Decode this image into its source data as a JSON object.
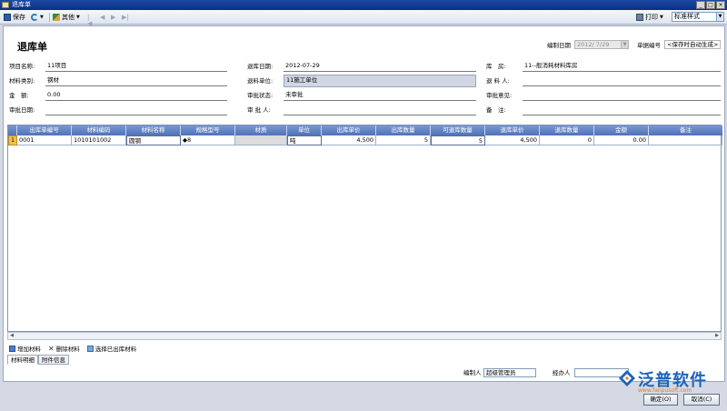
{
  "window": {
    "title": "退库单",
    "min": "_",
    "max": "□",
    "close": "×"
  },
  "toolbar": {
    "save_label": "保存",
    "other_label": "其他",
    "print_label": "打印",
    "template_value": "标准样式"
  },
  "header": {
    "title": "退库单",
    "date_label": "编制日期",
    "date_value": "2012/ 7/29",
    "no_label": "单据编号",
    "no_value": "<保存时自动生成>"
  },
  "form": {
    "project_label": "项目名称:",
    "project_value": "11项目",
    "return_date_label": "退库日期:",
    "return_date_value": "2012-07-29",
    "warehouse_label": "库　房:",
    "warehouse_value": "11--般消耗材料库房",
    "category_label": "材料类别:",
    "category_value": "钢材",
    "return_unit_label": "退料单位:",
    "return_unit_value": "11施工单位",
    "returner_label": "退 料 人:",
    "returner_value": "",
    "amount_label": "金　额:",
    "amount_value": "0.00",
    "approval_status_label": "审批状态:",
    "approval_status_value": "未审批",
    "approval_opinion_label": "审批意见:",
    "approval_opinion_value": "",
    "approval_date_label": "审批日期:",
    "approval_date_value": "",
    "approver_label": "审 批 人:",
    "approver_value": "",
    "remark_label": "备　注:",
    "remark_value": ""
  },
  "grid": {
    "columns": [
      "出库单编号",
      "材料编码",
      "材料名称",
      "规格型号",
      "材质",
      "单位",
      "出库单价",
      "出库数量",
      "可退库数量",
      "退库单价",
      "退库数量",
      "金额",
      "备注"
    ],
    "row": {
      "index": "1",
      "cells": [
        "0001",
        "1010101002",
        "圆钢",
        "◆8",
        "",
        "吨",
        "4,500",
        "5",
        "5",
        "4,500",
        "0",
        "0.00",
        ""
      ]
    }
  },
  "grid_toolbar": {
    "add_label": "增加材料",
    "delete_label": "删除材料",
    "pick_label": "选择已出库材料"
  },
  "tabs": [
    "材料明细",
    "附件信息"
  ],
  "footer": {
    "preparer_label": "编制人",
    "preparer_value": "超级管理员",
    "handler_label": "经办人",
    "handler_value": "",
    "ok_label": "确定(O)",
    "cancel_label": "取消(C)"
  },
  "logo": {
    "text": "泛普软件",
    "url": "www.fanpusoft.com"
  },
  "colors": {
    "title_bar": "#0a2f86",
    "grid_header": "#5b7dc0",
    "logo_blue": "#1e63b8",
    "logo_orange": "#e27a2b"
  }
}
